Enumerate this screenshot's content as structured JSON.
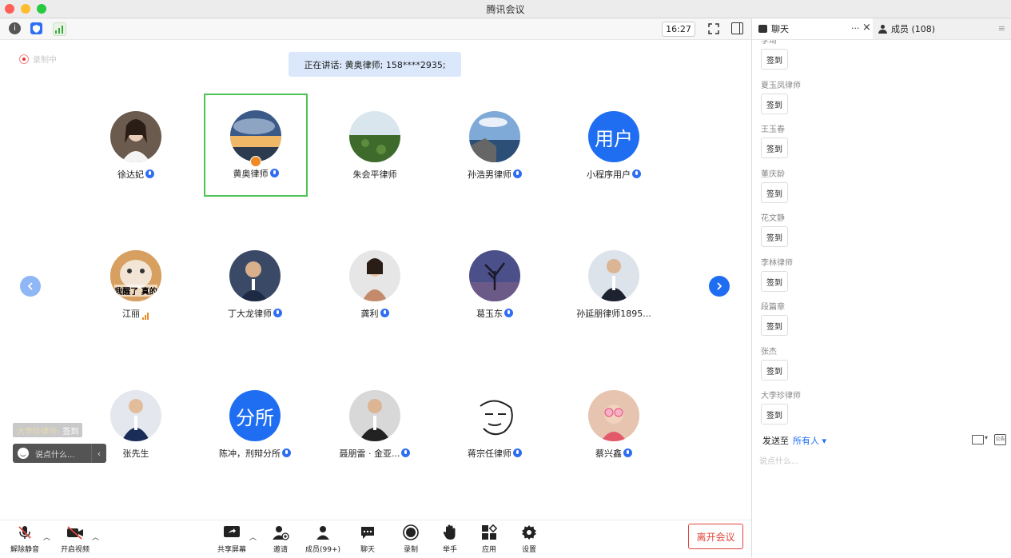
{
  "window": {
    "title": "腾讯会议"
  },
  "toolbar": {
    "clock": "16:27"
  },
  "recording": {
    "label": "录制中"
  },
  "speaking": {
    "text": "正在讲话: 黄奥律师; 158****2935;"
  },
  "participants": [
    {
      "name": "徐达妃",
      "audio": "mic"
    },
    {
      "name": "黄奥律师",
      "audio": "mic",
      "active": true
    },
    {
      "name": "朱会平律师",
      "audio": "none"
    },
    {
      "name": "孙浩男律师",
      "audio": "mic"
    },
    {
      "name": "小程序用户",
      "audio": "mic",
      "avatar_text": "用户"
    },
    {
      "name": "江丽",
      "audio": "bars",
      "avatar_text": "我醒了 真的"
    },
    {
      "name": "丁大龙律师",
      "audio": "mic"
    },
    {
      "name": "龚利",
      "audio": "mic"
    },
    {
      "name": "葛玉东",
      "audio": "mic"
    },
    {
      "name": "孙延朋律师1895...",
      "audio": "none"
    },
    {
      "name": "张先生",
      "audio": "none"
    },
    {
      "name": "陈冲，刑辩分所",
      "audio": "mic",
      "avatar_text": "分所"
    },
    {
      "name": "聂朋雷 · 金亚...",
      "audio": "mic"
    },
    {
      "name": "蒋宗任律师",
      "audio": "mic"
    },
    {
      "name": "蔡兴鑫",
      "audio": "mic"
    }
  ],
  "floating_chat": {
    "sender": "大李珍律师:",
    "message": "签到",
    "placeholder": "说点什么..."
  },
  "bottom": {
    "unmute": "解除静音",
    "video": "开启视频",
    "share": "共享屏幕",
    "invite": "邀请",
    "members": "成员(99+)",
    "chat": "聊天",
    "record": "录制",
    "raise_hand": "举手",
    "apps": "应用",
    "settings": "设置",
    "leave": "离开会议"
  },
  "panel": {
    "chat_tab": "聊天",
    "members_tab": "成员 (108)",
    "more": "···",
    "messages": [
      {
        "name": "李琦",
        "text": "签到"
      },
      {
        "name": "夏玉凤律师",
        "text": "签到"
      },
      {
        "name": "王玉春",
        "text": "签到"
      },
      {
        "name": "董庆龄",
        "text": "签到"
      },
      {
        "name": "花文静",
        "text": "签到"
      },
      {
        "name": "李林律师",
        "text": "签到"
      },
      {
        "name": "段篇章",
        "text": "签到"
      },
      {
        "name": "张杰",
        "text": "签到"
      },
      {
        "name": "大李珍律师",
        "text": "签到"
      }
    ],
    "send_to_label": "发送至",
    "send_to_target": "所有人",
    "input_placeholder": "说点什么..."
  },
  "colors": {
    "accent": "#1f6ef2",
    "active_speaker": "#4cc453",
    "leave": "#e0443a"
  }
}
